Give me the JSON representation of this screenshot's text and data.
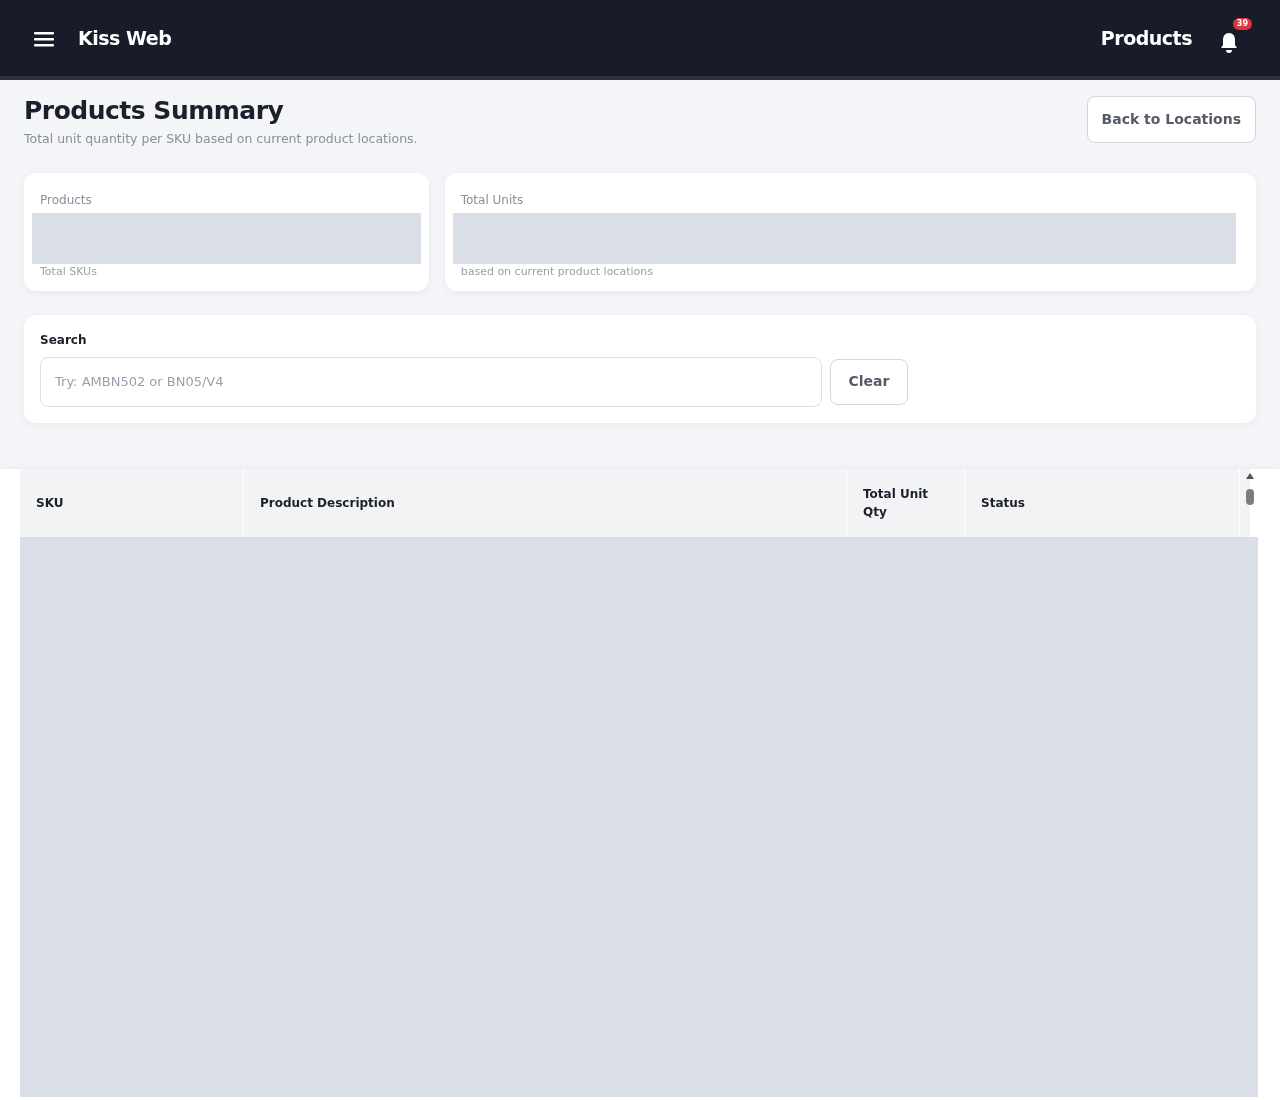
{
  "navbar": {
    "brand": "Kiss Web",
    "page": "Products",
    "notification_count": "39"
  },
  "header": {
    "title": "Products Summary",
    "subtitle": "Total unit quantity per SKU based on current product locations.",
    "back_button": "Back to Locations"
  },
  "stats": [
    {
      "label": "Products",
      "note": "Total SKUs",
      "loading": true
    },
    {
      "label": "Total Units",
      "note": "based on current product locations",
      "loading": true
    }
  ],
  "search": {
    "label": "Search",
    "placeholder": "Try: AMBN502 or BN05/V4",
    "clear_button": "Clear"
  },
  "table": {
    "columns": [
      "SKU",
      "Product Description",
      "Total Unit Qty",
      "Status"
    ],
    "loading": true
  }
}
